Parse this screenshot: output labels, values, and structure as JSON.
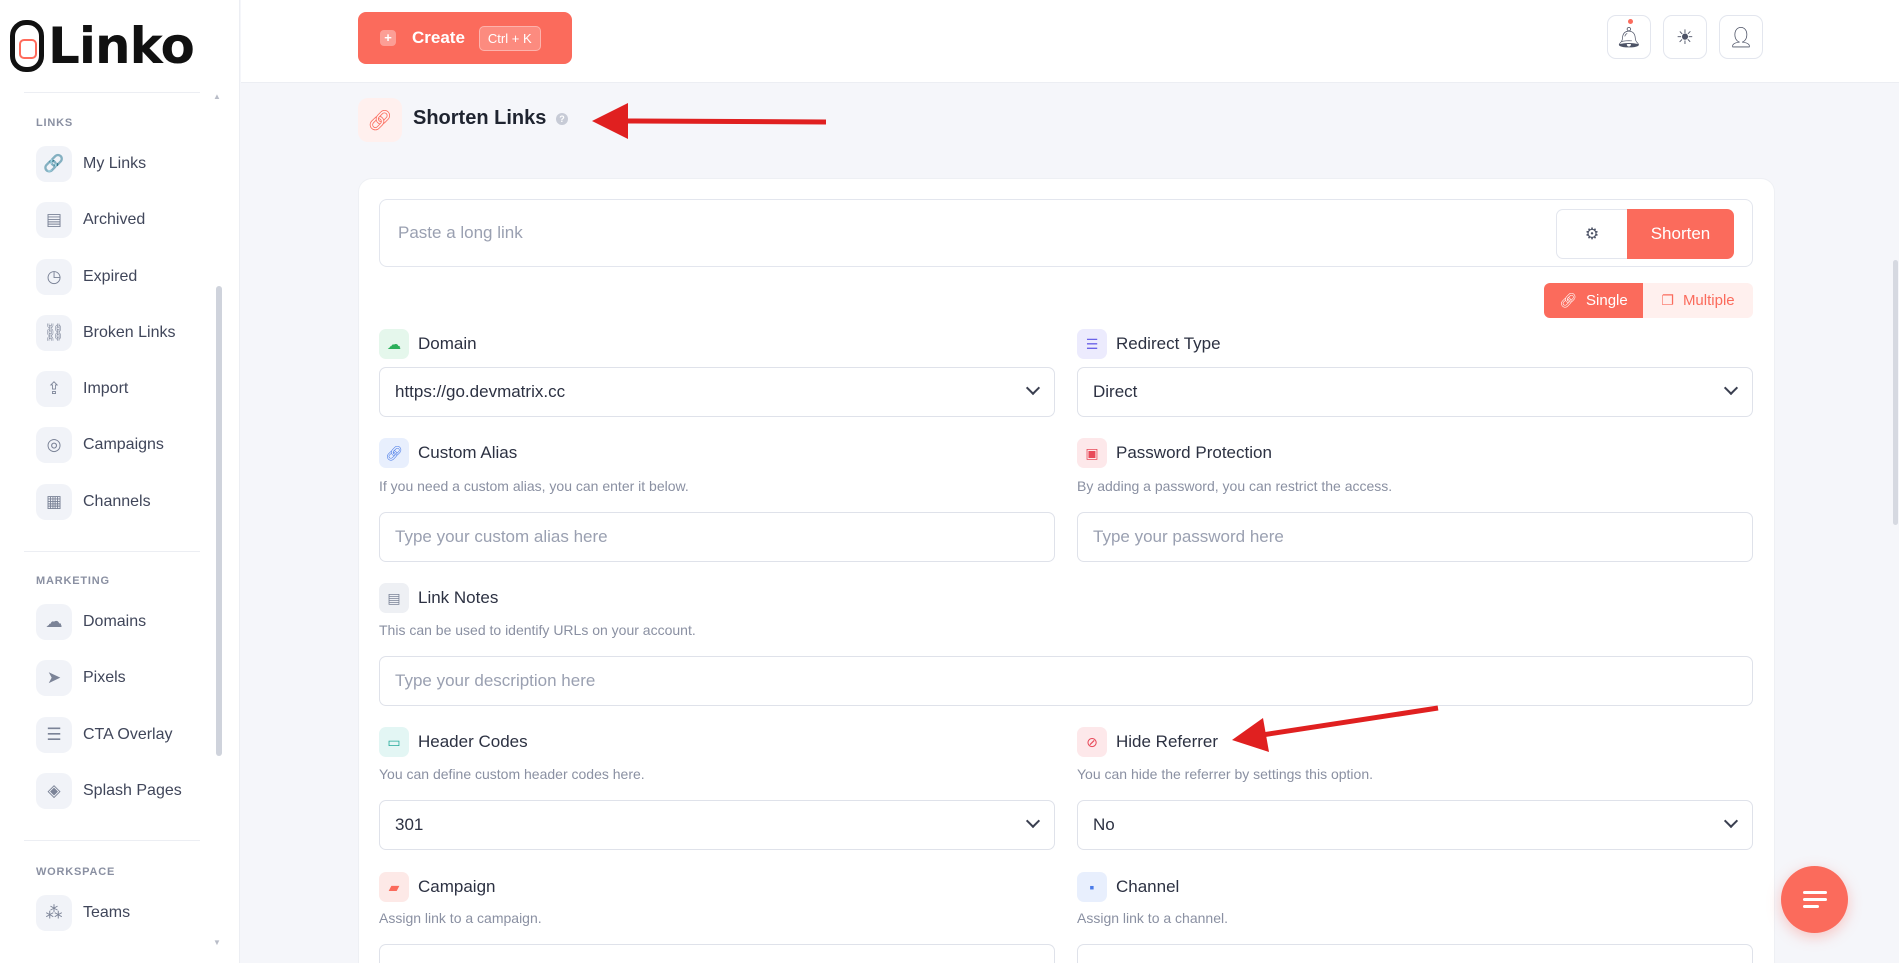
{
  "brand": {
    "name": "Linko"
  },
  "sidebar": {
    "sections": [
      {
        "title": "LINKS",
        "items": [
          {
            "label": "My Links",
            "icon": "link-icon"
          },
          {
            "label": "Archived",
            "icon": "archive-icon"
          },
          {
            "label": "Expired",
            "icon": "clock-icon"
          },
          {
            "label": "Broken Links",
            "icon": "broken-link-icon"
          },
          {
            "label": "Import",
            "icon": "import-icon"
          },
          {
            "label": "Campaigns",
            "icon": "target-icon"
          },
          {
            "label": "Channels",
            "icon": "grid-icon"
          }
        ]
      },
      {
        "title": "MARKETING",
        "items": [
          {
            "label": "Domains",
            "icon": "cloud-icon"
          },
          {
            "label": "Pixels",
            "icon": "compass-icon"
          },
          {
            "label": "CTA Overlay",
            "icon": "document-icon"
          },
          {
            "label": "Splash Pages",
            "icon": "layers-icon"
          }
        ]
      },
      {
        "title": "WORKSPACE",
        "items": [
          {
            "label": "Teams",
            "icon": "team-icon"
          }
        ]
      }
    ]
  },
  "topbar": {
    "create_label": "Create",
    "create_shortcut": "Ctrl + K",
    "icons": [
      "bell-icon",
      "sun-icon",
      "user-icon"
    ]
  },
  "page": {
    "title": "Shorten Links"
  },
  "form": {
    "url_placeholder": "Paste a long link",
    "shorten_label": "Shorten",
    "mode_single": "Single",
    "mode_multiple": "Multiple",
    "domain": {
      "label": "Domain",
      "value": "https://go.devmatrix.cc"
    },
    "redirect_type": {
      "label": "Redirect Type",
      "value": "Direct"
    },
    "custom_alias": {
      "label": "Custom Alias",
      "help": "If you need a custom alias, you can enter it below.",
      "placeholder": "Type your custom alias here"
    },
    "password": {
      "label": "Password Protection",
      "help": "By adding a password, you can restrict the access.",
      "placeholder": "Type your password here"
    },
    "link_notes": {
      "label": "Link Notes",
      "help": "This can be used to identify URLs on your account.",
      "placeholder": "Type your description here"
    },
    "header_codes": {
      "label": "Header Codes",
      "help": "You can define custom header codes here.",
      "value": "301"
    },
    "hide_referrer": {
      "label": "Hide Referrer",
      "help": "You can hide the referrer by settings this option.",
      "value": "No"
    },
    "campaign": {
      "label": "Campaign",
      "help": "Assign link to a campaign."
    },
    "channel": {
      "label": "Channel",
      "help": "Assign link to a channel."
    }
  },
  "colors": {
    "accent": "#fb6b5c",
    "annotation": "#e02020"
  }
}
